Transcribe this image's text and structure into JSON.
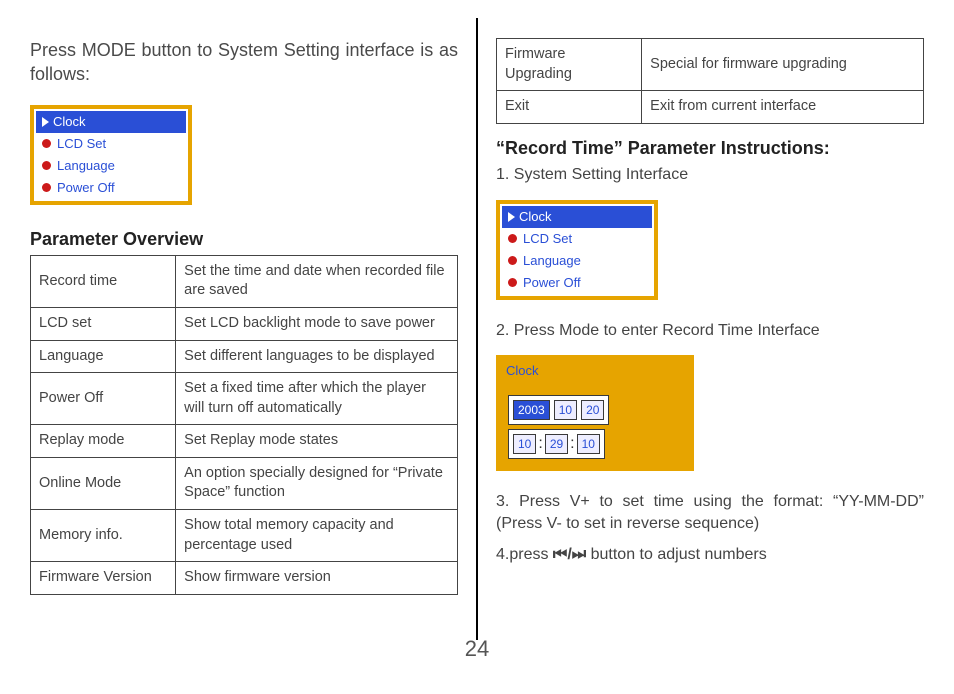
{
  "page_number": "24",
  "left": {
    "intro": "Press MODE button to System Setting interface is as follows:",
    "menu": {
      "items": [
        {
          "label": "Clock",
          "selected": true
        },
        {
          "label": "LCD Set",
          "selected": false
        },
        {
          "label": "Language",
          "selected": false
        },
        {
          "label": "Power Off",
          "selected": false
        }
      ]
    },
    "overview_heading": "Parameter Overview",
    "table": [
      {
        "k": "Record time",
        "v": "Set the time and date when recorded file are saved"
      },
      {
        "k": "LCD set",
        "v": "Set LCD backlight mode to save power"
      },
      {
        "k": "Language",
        "v": "Set different languages to be displayed"
      },
      {
        "k": "Power Off",
        "v": "Set a fixed time after which the player will turn off automatically"
      },
      {
        "k": "Replay mode",
        "v": "Set Replay mode states"
      },
      {
        "k": "Online Mode",
        "v": "An option specially designed for “Private Space” function"
      },
      {
        "k": "Memory info.",
        "v": "Show total memory capacity and percentage used"
      },
      {
        "k": "Firmware Version",
        "v": "Show firmware version"
      }
    ]
  },
  "right": {
    "top_table": [
      {
        "k": "Firmware Upgrading",
        "v": "Special for firmware upgrading"
      },
      {
        "k": "Exit",
        "v": "Exit from current interface"
      }
    ],
    "section_heading": "“Record Time” Parameter Instructions:",
    "step1": "1. System Setting Interface",
    "menu": {
      "items": [
        {
          "label": "Clock",
          "selected": true
        },
        {
          "label": "LCD Set",
          "selected": false
        },
        {
          "label": "Language",
          "selected": false
        },
        {
          "label": "Power Off",
          "selected": false
        }
      ]
    },
    "step2": "2. Press Mode to enter Record Time Interface",
    "clock": {
      "title": "Clock",
      "date": {
        "yy": "2003",
        "mm": "10",
        "dd": "20"
      },
      "time": {
        "h": "10",
        "m": "29",
        "s": "10"
      }
    },
    "step3": "3. Press V+ to set time using the format: “YY-MM-DD” (Press V- to set in reverse sequence)",
    "step4_pre": "4.press ",
    "step4_sym": "⏮/⏭",
    "step4_post": " button to adjust numbers"
  }
}
